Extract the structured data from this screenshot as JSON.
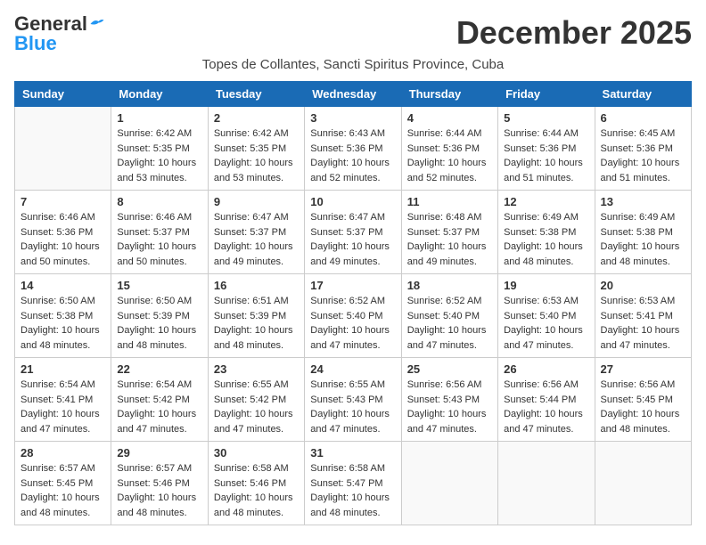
{
  "header": {
    "logo_general": "General",
    "logo_blue": "Blue",
    "month_title": "December 2025",
    "location": "Topes de Collantes, Sancti Spiritus Province, Cuba"
  },
  "weekdays": [
    "Sunday",
    "Monday",
    "Tuesday",
    "Wednesday",
    "Thursday",
    "Friday",
    "Saturday"
  ],
  "weeks": [
    [
      {
        "day": null
      },
      {
        "day": 1,
        "sunrise": "6:42 AM",
        "sunset": "5:35 PM",
        "daylight": "10 hours and 53 minutes."
      },
      {
        "day": 2,
        "sunrise": "6:42 AM",
        "sunset": "5:35 PM",
        "daylight": "10 hours and 53 minutes."
      },
      {
        "day": 3,
        "sunrise": "6:43 AM",
        "sunset": "5:36 PM",
        "daylight": "10 hours and 52 minutes."
      },
      {
        "day": 4,
        "sunrise": "6:44 AM",
        "sunset": "5:36 PM",
        "daylight": "10 hours and 52 minutes."
      },
      {
        "day": 5,
        "sunrise": "6:44 AM",
        "sunset": "5:36 PM",
        "daylight": "10 hours and 51 minutes."
      },
      {
        "day": 6,
        "sunrise": "6:45 AM",
        "sunset": "5:36 PM",
        "daylight": "10 hours and 51 minutes."
      }
    ],
    [
      {
        "day": 7,
        "sunrise": "6:46 AM",
        "sunset": "5:36 PM",
        "daylight": "10 hours and 50 minutes."
      },
      {
        "day": 8,
        "sunrise": "6:46 AM",
        "sunset": "5:37 PM",
        "daylight": "10 hours and 50 minutes."
      },
      {
        "day": 9,
        "sunrise": "6:47 AM",
        "sunset": "5:37 PM",
        "daylight": "10 hours and 49 minutes."
      },
      {
        "day": 10,
        "sunrise": "6:47 AM",
        "sunset": "5:37 PM",
        "daylight": "10 hours and 49 minutes."
      },
      {
        "day": 11,
        "sunrise": "6:48 AM",
        "sunset": "5:37 PM",
        "daylight": "10 hours and 49 minutes."
      },
      {
        "day": 12,
        "sunrise": "6:49 AM",
        "sunset": "5:38 PM",
        "daylight": "10 hours and 48 minutes."
      },
      {
        "day": 13,
        "sunrise": "6:49 AM",
        "sunset": "5:38 PM",
        "daylight": "10 hours and 48 minutes."
      }
    ],
    [
      {
        "day": 14,
        "sunrise": "6:50 AM",
        "sunset": "5:38 PM",
        "daylight": "10 hours and 48 minutes."
      },
      {
        "day": 15,
        "sunrise": "6:50 AM",
        "sunset": "5:39 PM",
        "daylight": "10 hours and 48 minutes."
      },
      {
        "day": 16,
        "sunrise": "6:51 AM",
        "sunset": "5:39 PM",
        "daylight": "10 hours and 48 minutes."
      },
      {
        "day": 17,
        "sunrise": "6:52 AM",
        "sunset": "5:40 PM",
        "daylight": "10 hours and 47 minutes."
      },
      {
        "day": 18,
        "sunrise": "6:52 AM",
        "sunset": "5:40 PM",
        "daylight": "10 hours and 47 minutes."
      },
      {
        "day": 19,
        "sunrise": "6:53 AM",
        "sunset": "5:40 PM",
        "daylight": "10 hours and 47 minutes."
      },
      {
        "day": 20,
        "sunrise": "6:53 AM",
        "sunset": "5:41 PM",
        "daylight": "10 hours and 47 minutes."
      }
    ],
    [
      {
        "day": 21,
        "sunrise": "6:54 AM",
        "sunset": "5:41 PM",
        "daylight": "10 hours and 47 minutes."
      },
      {
        "day": 22,
        "sunrise": "6:54 AM",
        "sunset": "5:42 PM",
        "daylight": "10 hours and 47 minutes."
      },
      {
        "day": 23,
        "sunrise": "6:55 AM",
        "sunset": "5:42 PM",
        "daylight": "10 hours and 47 minutes."
      },
      {
        "day": 24,
        "sunrise": "6:55 AM",
        "sunset": "5:43 PM",
        "daylight": "10 hours and 47 minutes."
      },
      {
        "day": 25,
        "sunrise": "6:56 AM",
        "sunset": "5:43 PM",
        "daylight": "10 hours and 47 minutes."
      },
      {
        "day": 26,
        "sunrise": "6:56 AM",
        "sunset": "5:44 PM",
        "daylight": "10 hours and 47 minutes."
      },
      {
        "day": 27,
        "sunrise": "6:56 AM",
        "sunset": "5:45 PM",
        "daylight": "10 hours and 48 minutes."
      }
    ],
    [
      {
        "day": 28,
        "sunrise": "6:57 AM",
        "sunset": "5:45 PM",
        "daylight": "10 hours and 48 minutes."
      },
      {
        "day": 29,
        "sunrise": "6:57 AM",
        "sunset": "5:46 PM",
        "daylight": "10 hours and 48 minutes."
      },
      {
        "day": 30,
        "sunrise": "6:58 AM",
        "sunset": "5:46 PM",
        "daylight": "10 hours and 48 minutes."
      },
      {
        "day": 31,
        "sunrise": "6:58 AM",
        "sunset": "5:47 PM",
        "daylight": "10 hours and 48 minutes."
      },
      {
        "day": null
      },
      {
        "day": null
      },
      {
        "day": null
      }
    ]
  ]
}
